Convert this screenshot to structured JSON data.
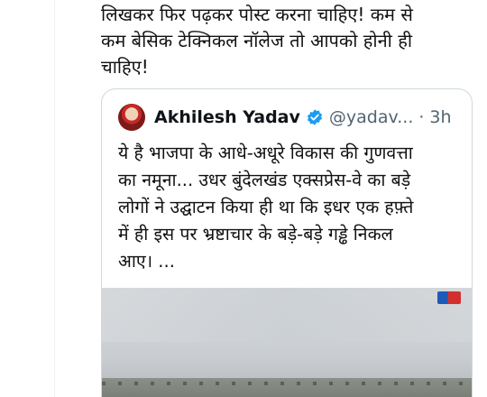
{
  "tweet": {
    "text": "लिखकर फिर पढ़कर पोस्ट करना चाहिए! कम से\nकम बेसिक टेक्निकल नॉलेज तो आपको होनी ही\nचाहिए!"
  },
  "quoted_tweet": {
    "author_name": "Akhilesh Yadav",
    "handle": "@yadav...",
    "separator": "·",
    "time": "3h",
    "text": "ये है भाजपा के आधे-अधूरे विकास की गुणवत्ता\nका नमूना... उधर बुंदेलखंड एक्सप्रेस-वे का बड़े\nलोगों ने उद्घाटन किया ही था कि इधर एक हफ़्ते\nमें ही इस पर भ्रष्टाचार के बड़े-बड़े गड्ढे निकल\nआए। ...",
    "verified_icon": "verified-badge-icon",
    "accent_color": "#1d9bf0"
  }
}
